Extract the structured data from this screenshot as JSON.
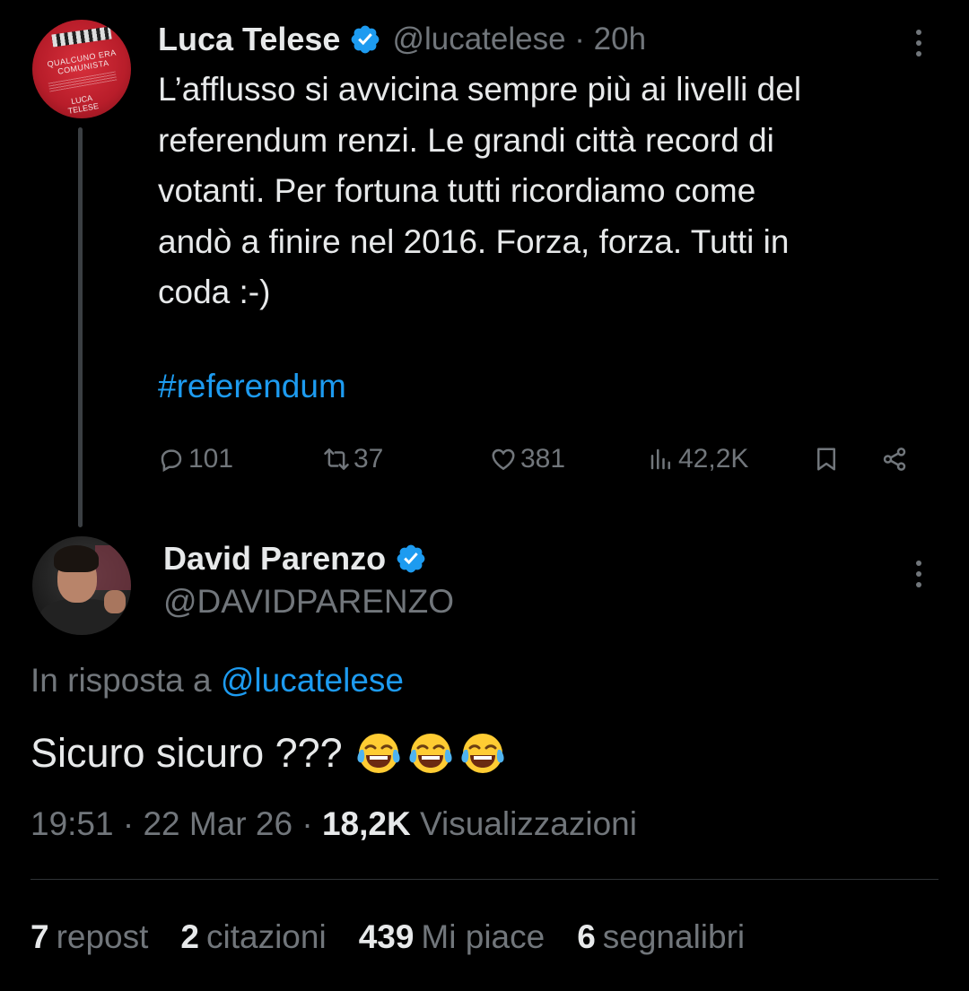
{
  "tweet": {
    "author_name": "Luca Telese",
    "author_handle": "@lucatelese · 20h",
    "avatar_text": [
      "QUALCUNO ERA COMUNISTA",
      "LUCA TELESE"
    ],
    "text": "L’afflusso si avvicina sempre più ai livelli del\nreferendum renzi. Le grandi città record di\nvotanti. Per fortuna tutti ricordiamo come\nandò a finire nel 2016. Forza, forza. Tutti in\ncoda :-)",
    "hashtag": "#referendum",
    "actions": {
      "replies": "101",
      "reposts": "37",
      "likes": "381",
      "views": "42,2K"
    }
  },
  "reply": {
    "author_name": "David Parenzo",
    "author_handle": "@DAVIDPARENZO",
    "in_reply_prefix": "In risposta a",
    "in_reply_mention": "@lucatelese",
    "text": "Sicuro sicuro ???",
    "time_date": "19:51 · 22 Mar 26 · ",
    "views_count": "18,2K",
    "views_label": "Visualizzazioni"
  },
  "stats": [
    {
      "count": "7",
      "label": "repost"
    },
    {
      "count": "2",
      "label": "citazioni"
    },
    {
      "count": "439",
      "label": "Mi piace"
    },
    {
      "count": "6",
      "label": "segnalibri"
    }
  ],
  "colors": {
    "background": "#000000",
    "text": "#e7e9ea",
    "muted": "#71767b",
    "accent": "#1d9bf0",
    "divider": "#2f3336"
  },
  "icons": [
    "verified-badge-icon",
    "more-options-icon",
    "reply-icon",
    "repost-icon",
    "like-icon",
    "views-icon",
    "bookmark-icon",
    "share-icon",
    "laughing-tears-emoji"
  ]
}
